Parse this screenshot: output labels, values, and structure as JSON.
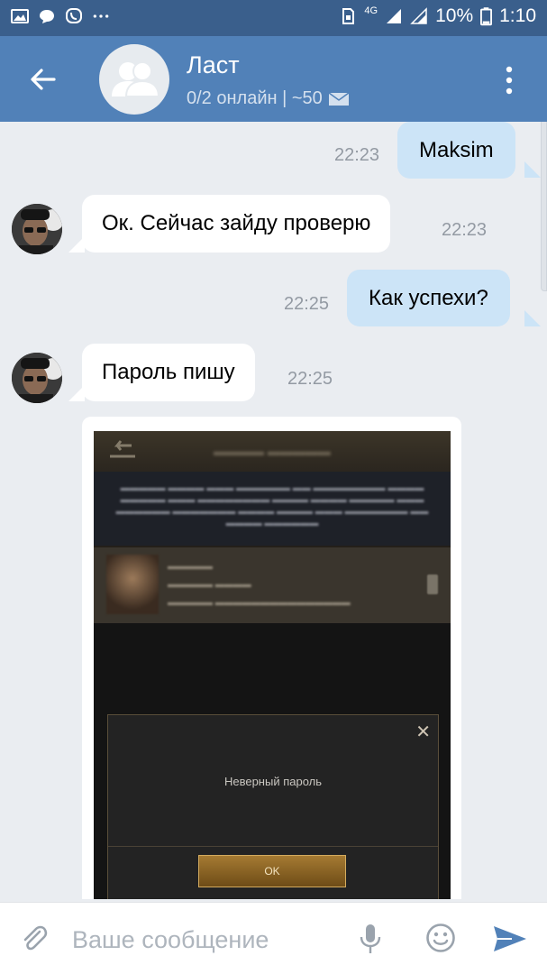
{
  "status_bar": {
    "network": "4G",
    "battery": "10%",
    "time": "1:10"
  },
  "header": {
    "title": "Ласт",
    "subtitle": "0/2 онлайн | ~50"
  },
  "messages": [
    {
      "direction": "out",
      "text": "Maksim",
      "time": "22:23"
    },
    {
      "direction": "in",
      "text": "Ок. Сейчас зайду проверю",
      "time": "22:23"
    },
    {
      "direction": "out",
      "text": "Как успехи?",
      "time": "22:25"
    },
    {
      "direction": "in",
      "text": "Пароль пишу",
      "time": "22:25"
    }
  ],
  "attachment": {
    "dialog_text": "Неверный пароль",
    "ok_label": "OK"
  },
  "composer": {
    "placeholder": "Ваше сообщение"
  },
  "colors": {
    "header": "#5181b8",
    "status_bar": "#3a5f8c",
    "outgoing_bubble": "#cce4f7",
    "incoming_bubble": "#ffffff",
    "background": "#eaedf1",
    "send": "#5181b8"
  }
}
